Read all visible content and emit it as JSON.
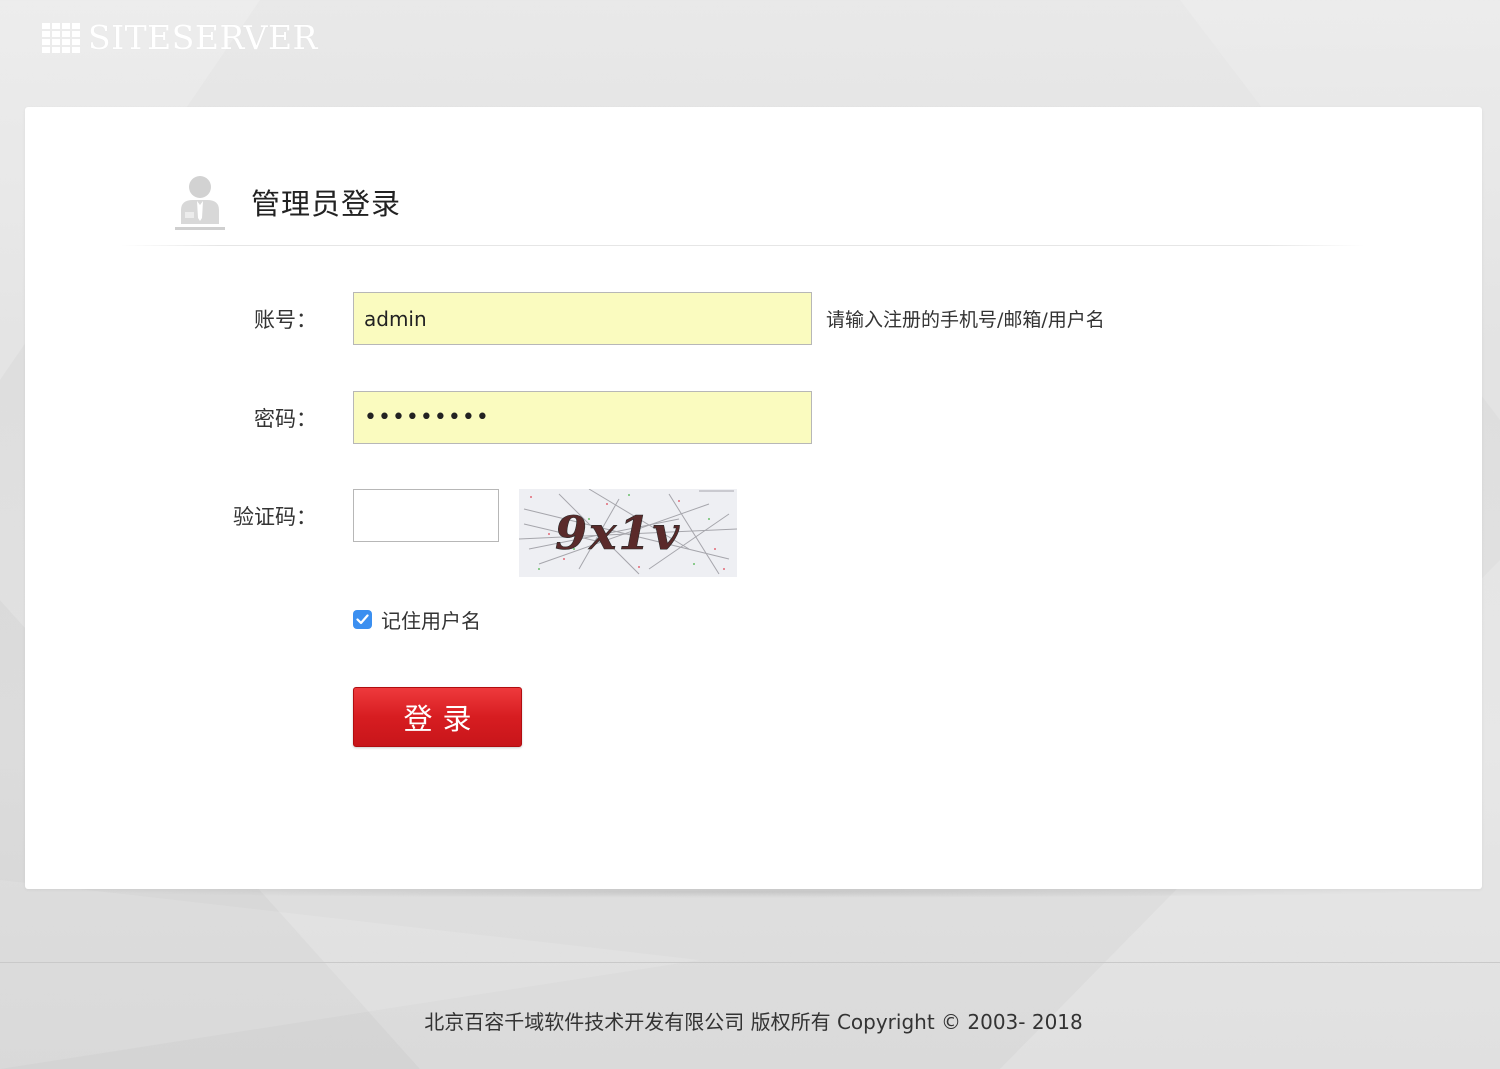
{
  "header": {
    "logo_text": "SITESERVER",
    "logo_icon": "grid-logo-icon"
  },
  "panel": {
    "title": "管理员登录",
    "title_icon": "admin-user-icon"
  },
  "form": {
    "account": {
      "label": "账号：",
      "value": "admin",
      "hint": "请输入注册的手机号/邮箱/用户名"
    },
    "password": {
      "label": "密码：",
      "value": "•••••••••"
    },
    "captcha": {
      "label": "验证码：",
      "value": "",
      "image_text": "9x1v"
    },
    "remember": {
      "label": "记住用户名",
      "checked": true
    },
    "submit_label": "登录"
  },
  "footer": {
    "copyright": "北京百容千域软件技术开发有限公司 版权所有 Copyright © 2003- 2018"
  },
  "colors": {
    "input_fill": "#fafbbf",
    "button_red": "#d71d21",
    "checkbox_blue": "#3b8ff0"
  }
}
